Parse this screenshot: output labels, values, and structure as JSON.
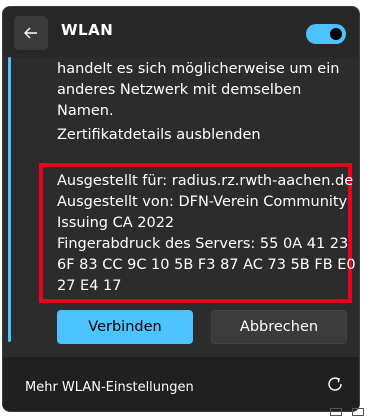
{
  "header": {
    "back_icon": "arrow-left-icon",
    "title": "WLAN",
    "toggle_on": true
  },
  "info": {
    "lines": [
      "handelt es sich möglicherweise um ein",
      "anderes Netzwerk mit demselben",
      "Namen."
    ],
    "cert_details_link": "Zertifikatdetails ausblenden"
  },
  "certificate": {
    "lines": [
      "Ausgestellt für: radius.rz.rwth-aachen.de",
      "Ausgestellt von: DFN-Verein Community",
      "Issuing CA 2022",
      "Fingerabdruck des Servers: 55 0A 41 23",
      "6F 83 CC 9C 10 5B F3 87 AC 73 5B FB E0",
      "27 E4 17"
    ]
  },
  "actions": {
    "connect_label": "Verbinden",
    "cancel_label": "Abbrechen"
  },
  "footer": {
    "more_settings_label": "Mehr WLAN-Einstellungen",
    "refresh_icon": "refresh-icon"
  },
  "colors": {
    "accent": "#4cc2ff",
    "highlight_box": "#e8001c",
    "background": "#2c2c2c"
  }
}
